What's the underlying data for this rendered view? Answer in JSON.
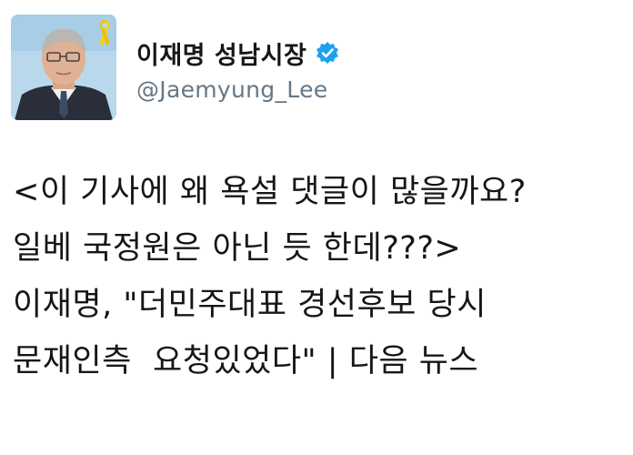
{
  "account": {
    "display_name": "이재명 성남시장",
    "handle": "@Jaemyung_Lee",
    "verified_icon": "verified-badge-icon",
    "badge_color": "#1da1f2",
    "ribbon_color": "#f2d21b"
  },
  "tweet": {
    "lines": [
      "<이 기사에 왜 욕설 댓글이 많을까요?",
      "일베 국정원은 아닌 듯 한데???>",
      "이재명, \"더민주대표 경선후보 당시",
      "문재인측  요청있었다\" | 다음 뉴스"
    ]
  }
}
